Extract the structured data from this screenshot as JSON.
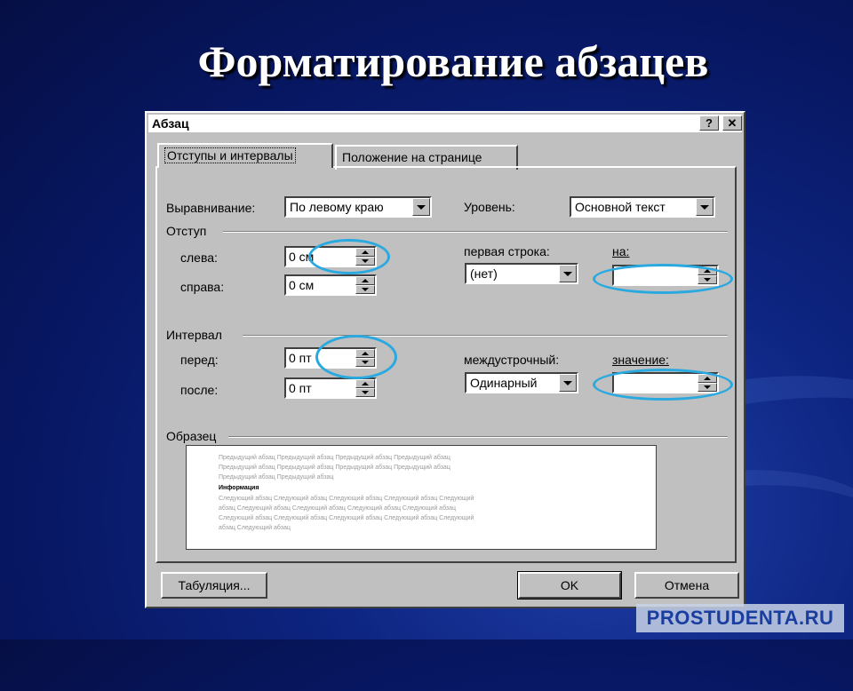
{
  "slide": {
    "title": "Форматирование абзацев"
  },
  "dialog": {
    "title": "Абзац",
    "help_button": "?",
    "close_button": "✕",
    "tabs": [
      {
        "label": "Отступы и интервалы",
        "active": true
      },
      {
        "label": "Положение на странице",
        "active": false
      }
    ],
    "alignment": {
      "label": "Выравнивание:",
      "value": "По левому краю"
    },
    "level": {
      "label": "Уровень:",
      "value": "Основной текст"
    },
    "indent": {
      "section_label": "Отступ",
      "left": {
        "label": "слева:",
        "value": "0 см"
      },
      "right": {
        "label": "справа:",
        "value": "0 см"
      },
      "first_line": {
        "label": "первая строка:",
        "value": "(нет)"
      },
      "by": {
        "label": "на:",
        "value": ""
      }
    },
    "spacing": {
      "section_label": "Интервал",
      "before": {
        "label": "перед:",
        "value": "0 пт"
      },
      "after": {
        "label": "после:",
        "value": "0 пт"
      },
      "line_spacing": {
        "label": "междустрочный:",
        "value": "Одинарный"
      },
      "at": {
        "label": "значение:",
        "value": ""
      }
    },
    "sample": {
      "section_label": "Образец",
      "prev_lines": [
        "Предыдущий абзац Предыдущий абзац Предыдущий абзац Предыдущий абзац",
        "Предыдущий абзац Предыдущий абзац Предыдущий абзац Предыдущий абзац",
        "Предыдущий абзац Предыдущий абзац"
      ],
      "current": "Информация",
      "next_lines": [
        "Следующий абзац Следующий абзац Следующий абзац Следующий абзац Следующий",
        "абзац Следующий абзац Следующий абзац Следующий абзац Следующий абзац",
        "Следующий абзац Следующий абзац Следующий абзац Следующий абзац Следующий",
        "абзац Следующий абзац"
      ]
    },
    "buttons": {
      "tabs": "Табуляция...",
      "ok": "OK",
      "cancel": "Отмена"
    }
  },
  "watermark": "PROSTUDENTA.RU",
  "colors": {
    "highlight_ring": "#2aa9e0",
    "background": "#0d2480"
  }
}
